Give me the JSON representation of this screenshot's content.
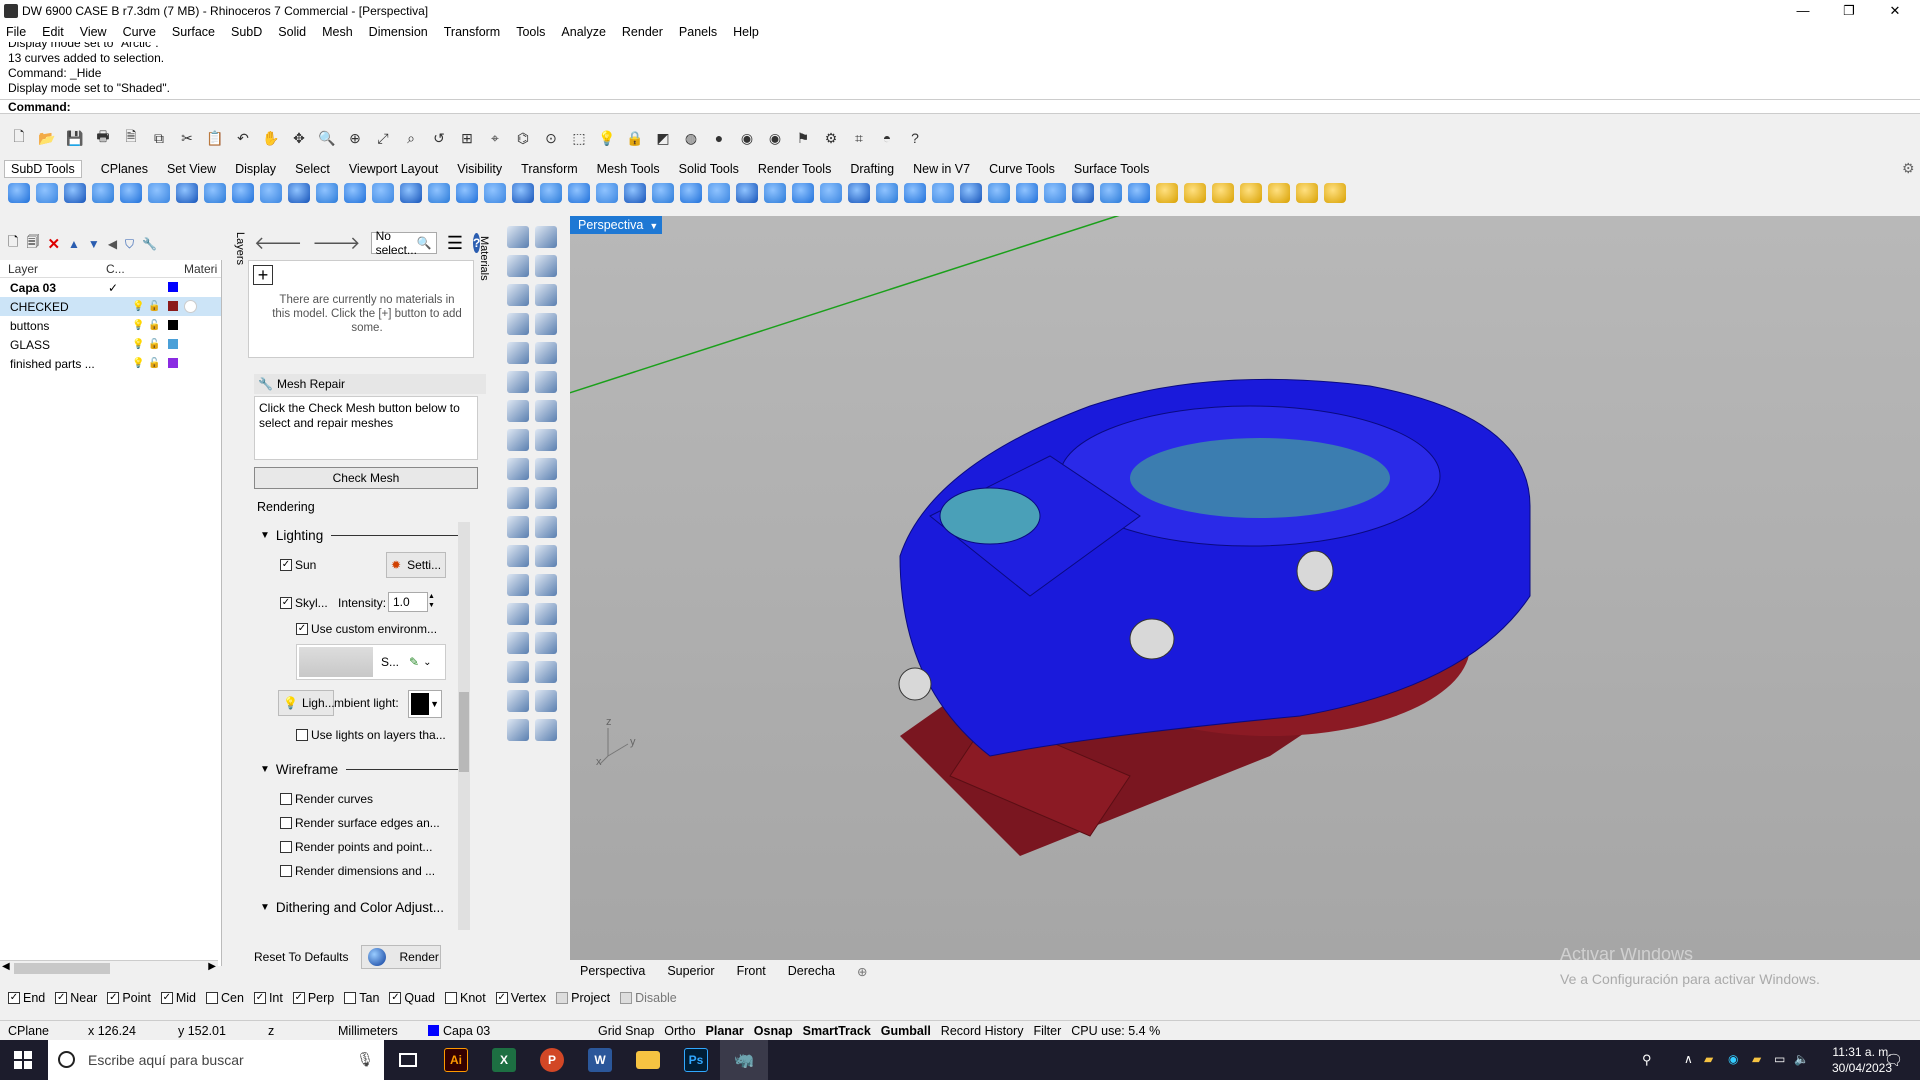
{
  "window": {
    "title": "DW 6900 CASE B r7.3dm (7 MB) - Rhinoceros 7 Commercial - [Perspectiva]",
    "minimize": "—",
    "maximize": "❐",
    "close": "✕"
  },
  "menu": [
    "File",
    "Edit",
    "View",
    "Curve",
    "Surface",
    "SubD",
    "Solid",
    "Mesh",
    "Dimension",
    "Transform",
    "Tools",
    "Analyze",
    "Render",
    "Panels",
    "Help"
  ],
  "command_history": [
    "Display mode set to \"Arctic\".",
    "13 curves added to selection.",
    "Command: _Hide",
    "Display mode set to \"Shaded\"."
  ],
  "command_prompt": "Command:",
  "toolbar_tabs": [
    "SubD Tools",
    "CPlanes",
    "Set View",
    "Display",
    "Select",
    "Viewport Layout",
    "Visibility",
    "Transform",
    "Mesh Tools",
    "Solid Tools",
    "Render Tools",
    "Drafting",
    "New in V7",
    "Curve Tools",
    "Surface Tools"
  ],
  "layers": {
    "headers": {
      "layer": "Layer",
      "current": "C...",
      "material": "Materi"
    },
    "rows": [
      {
        "name": "Capa 03",
        "current": "✓",
        "color": "#0000ff",
        "selected": false,
        "bold": true
      },
      {
        "name": "CHECKED",
        "current": "",
        "color": "#8b1a1a",
        "selected": true,
        "bold": false
      },
      {
        "name": "buttons",
        "current": "",
        "color": "#000000",
        "selected": false,
        "bold": false
      },
      {
        "name": "GLASS",
        "current": "",
        "color": "#4aa0d8",
        "selected": false,
        "bold": false
      },
      {
        "name": "finished parts ...",
        "current": "",
        "color": "#8a2be2",
        "selected": false,
        "bold": false
      }
    ],
    "tab_label": "Layers"
  },
  "materials": {
    "search_placeholder": "No select...",
    "empty_message": "There are currently no materials in this model. Click the [+] button to add some.",
    "tab_label": "Materials",
    "add": "+"
  },
  "mesh_repair": {
    "title": "Mesh Repair",
    "text": "Click the Check Mesh button below to select and repair meshes",
    "button": "Check Mesh"
  },
  "rendering": {
    "title": "Rendering",
    "lighting": "Lighting",
    "sun": "Sun",
    "sun_settings": "Setti...",
    "skylight": "Skyl...",
    "intensity_label": "Intensity:",
    "intensity": "1.0",
    "use_custom_env": "Use custom environm...",
    "env_short": "S...",
    "lights_btn": "Ligh...",
    "ambient_label": "mbient light:",
    "use_lights_layers": "Use lights on layers tha...",
    "wireframe": "Wireframe",
    "render_curves": "Render curves",
    "render_surface_edges": "Render surface edges an...",
    "render_points": "Render points and point...",
    "render_dims": "Render dimensions and ...",
    "dithering": "Dithering and Color Adjust...",
    "reset": "Reset To Defaults",
    "render": "Render"
  },
  "viewport": {
    "name": "Perspectiva",
    "axis_z": "z",
    "axis_y": "y",
    "axis_x": "x",
    "watermark1": "Activar Windows",
    "watermark2": "Ve a Configuración para activar Windows."
  },
  "viewport_tabs": [
    "Perspectiva",
    "Superior",
    "Front",
    "Derecha"
  ],
  "osnaps": [
    {
      "label": "End",
      "checked": true
    },
    {
      "label": "Near",
      "checked": true
    },
    {
      "label": "Point",
      "checked": true
    },
    {
      "label": "Mid",
      "checked": true
    },
    {
      "label": "Cen",
      "checked": false
    },
    {
      "label": "Int",
      "checked": true
    },
    {
      "label": "Perp",
      "checked": true
    },
    {
      "label": "Tan",
      "checked": false
    },
    {
      "label": "Quad",
      "checked": true
    },
    {
      "label": "Knot",
      "checked": false
    },
    {
      "label": "Vertex",
      "checked": true
    },
    {
      "label": "Project",
      "checked": false
    },
    {
      "label": "Disable",
      "checked": false
    }
  ],
  "statusbar": {
    "cplane": "CPlane",
    "x": "x 126.24",
    "y": "y 152.01",
    "z": "z",
    "units": "Millimeters",
    "layer": "Capa 03",
    "grid_snap": "Grid Snap",
    "ortho": "Ortho",
    "planar": "Planar",
    "osnap": "Osnap",
    "smarttrack": "SmartTrack",
    "gumball": "Gumball",
    "record_history": "Record History",
    "filter": "Filter",
    "cpu": "CPU use: 5.4 %"
  },
  "taskbar": {
    "search_placeholder": "Escribe aquí para buscar",
    "time": "11:31 a. m.",
    "date": "30/04/2023"
  },
  "colors": {
    "accent": "#1e78d4",
    "model_blue": "#1a1adb",
    "model_red": "#8b1a24",
    "glass": "#4aa0b8"
  }
}
